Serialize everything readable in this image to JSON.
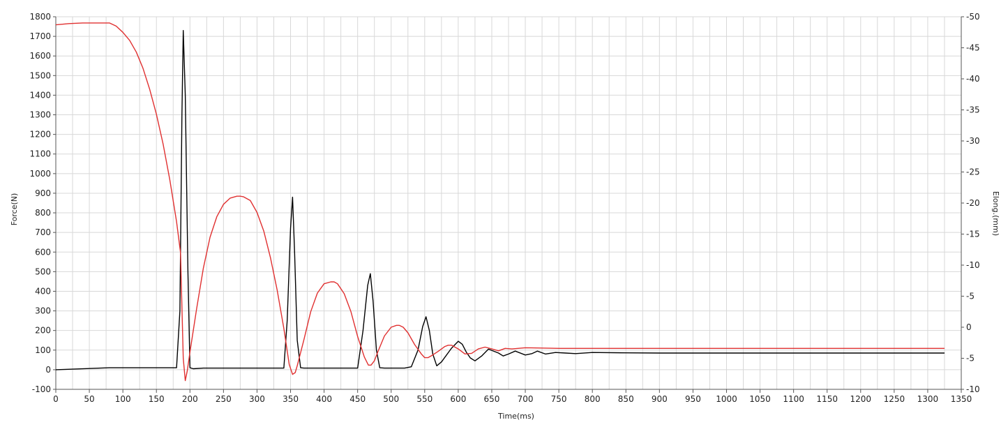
{
  "chart_data": {
    "type": "line",
    "xlabel": "Time(ms)",
    "ylabel": "Force(N)",
    "y2label": "Elong.(mm)",
    "xlim": [
      0,
      1350
    ],
    "ylim": [
      -100,
      1800
    ],
    "y2lim": [
      -10,
      50
    ],
    "grid": true,
    "x_ticks": [
      0,
      50,
      100,
      150,
      200,
      250,
      300,
      350,
      400,
      450,
      500,
      550,
      600,
      650,
      700,
      750,
      800,
      850,
      900,
      950,
      1000,
      1050,
      1100,
      1150,
      1200,
      1250,
      1300,
      1350
    ],
    "y_ticks": [
      -100,
      0,
      100,
      200,
      300,
      400,
      500,
      600,
      700,
      800,
      900,
      1000,
      1100,
      1200,
      1300,
      1400,
      1500,
      1600,
      1700,
      1800
    ],
    "y2_ticks": [
      -10,
      -5,
      0,
      5,
      10,
      15,
      20,
      25,
      30,
      35,
      40,
      45,
      50
    ],
    "series": [
      {
        "axis": "left",
        "color": "#000000",
        "x": [
          0,
          80,
          150,
          180,
          185,
          188,
          190,
          193,
          197,
          200,
          205,
          220,
          260,
          300,
          340,
          345,
          350,
          353,
          356,
          360,
          365,
          370,
          400,
          450,
          458,
          465,
          469,
          473,
          478,
          483,
          490,
          520,
          530,
          540,
          547,
          552,
          557,
          562,
          568,
          575,
          590,
          600,
          606,
          612,
          618,
          625,
          635,
          645,
          660,
          667,
          675,
          685,
          700,
          710,
          718,
          730,
          745,
          760,
          775,
          800,
          850,
          900,
          1000,
          1100,
          1200,
          1325
        ],
        "y": [
          0,
          10,
          10,
          10,
          300,
          1300,
          1730,
          1400,
          500,
          10,
          5,
          8,
          8,
          8,
          8,
          250,
          720,
          880,
          600,
          150,
          10,
          8,
          8,
          8,
          200,
          430,
          490,
          350,
          100,
          10,
          8,
          8,
          15,
          100,
          220,
          270,
          200,
          80,
          20,
          40,
          110,
          145,
          130,
          90,
          60,
          45,
          70,
          105,
          85,
          70,
          80,
          95,
          75,
          82,
          95,
          80,
          88,
          85,
          82,
          88,
          86,
          85,
          85,
          85,
          85,
          85
        ]
      },
      {
        "axis": "right",
        "color": "#e03030",
        "x": [
          0,
          20,
          40,
          60,
          80,
          90,
          100,
          110,
          120,
          130,
          140,
          150,
          160,
          170,
          180,
          186,
          190,
          193,
          196,
          200,
          210,
          220,
          230,
          240,
          250,
          260,
          270,
          275,
          280,
          290,
          300,
          310,
          320,
          330,
          340,
          348,
          353,
          357,
          360,
          370,
          380,
          390,
          400,
          410,
          415,
          420,
          430,
          440,
          450,
          460,
          466,
          470,
          475,
          480,
          490,
          500,
          508,
          512,
          518,
          525,
          535,
          545,
          550,
          555,
          560,
          570,
          580,
          585,
          590,
          600,
          610,
          620,
          630,
          640,
          650,
          660,
          670,
          680,
          700,
          750,
          800,
          900,
          1000,
          1100,
          1200,
          1325
        ],
        "y": [
          48.7,
          48.9,
          49.0,
          49.0,
          49.0,
          48.5,
          47.5,
          46.2,
          44.3,
          41.7,
          38.3,
          34.3,
          29.5,
          23.7,
          17.0,
          12.0,
          -5.0,
          -8.6,
          -7.0,
          -4.0,
          3.0,
          9.5,
          14.5,
          17.8,
          19.8,
          20.8,
          21.1,
          21.1,
          21.0,
          20.4,
          18.5,
          15.5,
          11.2,
          6.0,
          -0.2,
          -6.0,
          -7.6,
          -7.3,
          -6.2,
          -2.0,
          2.5,
          5.5,
          7.0,
          7.3,
          7.3,
          7.0,
          5.4,
          2.5,
          -1.5,
          -4.8,
          -6.1,
          -6.1,
          -5.4,
          -4.0,
          -1.4,
          0.0,
          0.3,
          0.3,
          0.0,
          -0.9,
          -2.8,
          -4.3,
          -4.9,
          -4.9,
          -4.6,
          -3.9,
          -3.1,
          -2.9,
          -2.9,
          -3.5,
          -4.3,
          -4.2,
          -3.5,
          -3.2,
          -3.5,
          -3.8,
          -3.4,
          -3.5,
          -3.3,
          -3.4,
          -3.4,
          -3.4,
          -3.4,
          -3.4,
          -3.4,
          -3.4
        ]
      }
    ]
  }
}
